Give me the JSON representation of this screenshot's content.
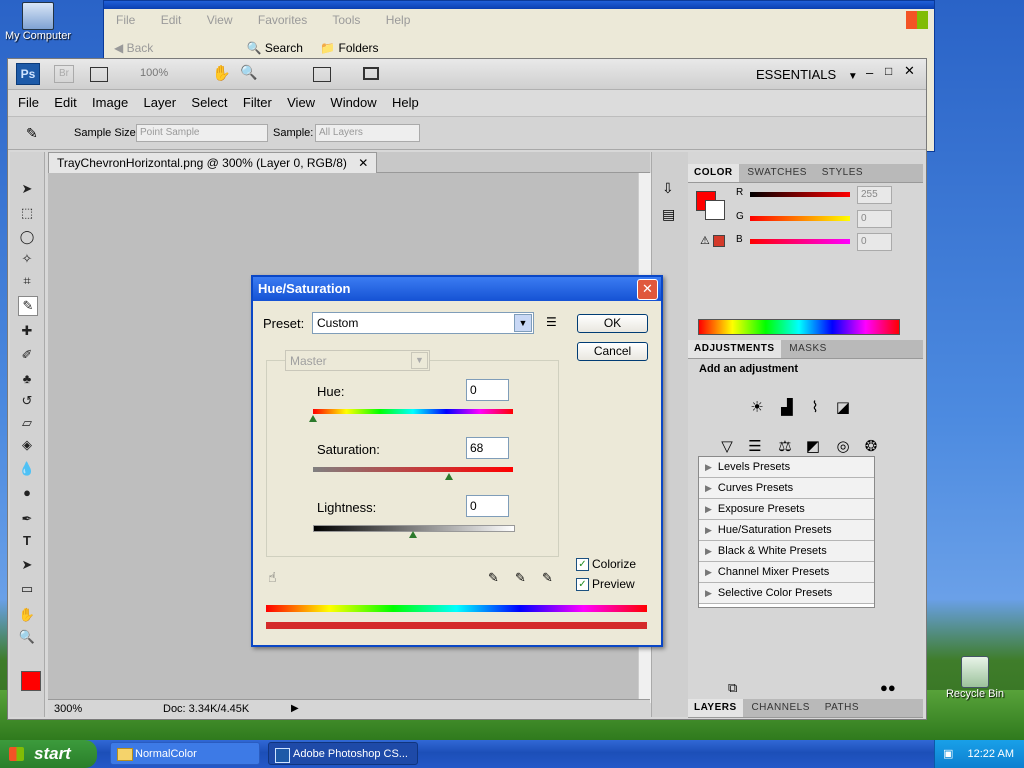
{
  "desktop": {
    "my_computer": "My Computer",
    "recycle_bin": "Recycle Bin"
  },
  "explorer": {
    "title": "NormalColor",
    "menu": [
      "File",
      "Edit",
      "View",
      "Favorites",
      "Tools",
      "Help"
    ],
    "toolbar": {
      "back": "Back",
      "search": "Search",
      "folders": "Folders"
    }
  },
  "photoshop": {
    "logo": "Ps",
    "bridge": "Br",
    "zoom": "100%",
    "workspace": "ESSENTIALS",
    "menu": [
      "File",
      "Edit",
      "Image",
      "Layer",
      "Select",
      "Filter",
      "View",
      "Window",
      "Help"
    ],
    "options": {
      "sample_size_label": "Sample Size:",
      "sample_size_value": "Point Sample",
      "sample_label": "Sample:",
      "sample_value": "All Layers"
    },
    "document_tab": "TrayChevronHorizontal.png @ 300% (Layer 0, RGB/8)",
    "status": {
      "zoom": "300%",
      "doc": "Doc: 3.34K/4.45K"
    },
    "color_panel": {
      "tabs": [
        "COLOR",
        "SWATCHES",
        "STYLES"
      ],
      "r_label": "R",
      "g_label": "G",
      "b_label": "B",
      "r_value": "255",
      "g_value": "0",
      "b_value": "0",
      "fg_color": "#ff0000"
    },
    "adjustments_panel": {
      "tabs": [
        "ADJUSTMENTS",
        "MASKS"
      ],
      "heading": "Add an adjustment",
      "presets": [
        "Levels Presets",
        "Curves Presets",
        "Exposure Presets",
        "Hue/Saturation Presets",
        "Black & White Presets",
        "Channel Mixer Presets",
        "Selective Color Presets"
      ]
    },
    "layers_panel": {
      "tabs": [
        "LAYERS",
        "CHANNELS",
        "PATHS"
      ]
    }
  },
  "dialog": {
    "title": "Hue/Saturation",
    "preset_label": "Preset:",
    "preset_value": "Custom",
    "channel_value": "Master",
    "hue_label": "Hue:",
    "hue_value": "0",
    "saturation_label": "Saturation:",
    "saturation_value": "68",
    "lightness_label": "Lightness:",
    "lightness_value": "0",
    "ok": "OK",
    "cancel": "Cancel",
    "colorize_label": "Colorize",
    "preview_label": "Preview",
    "colorize_checked": true,
    "preview_checked": true,
    "result_color": "#d42a2a"
  },
  "taskbar": {
    "start": "start",
    "tasks": [
      "NormalColor",
      "Adobe Photoshop CS..."
    ],
    "clock": "12:22 AM"
  }
}
